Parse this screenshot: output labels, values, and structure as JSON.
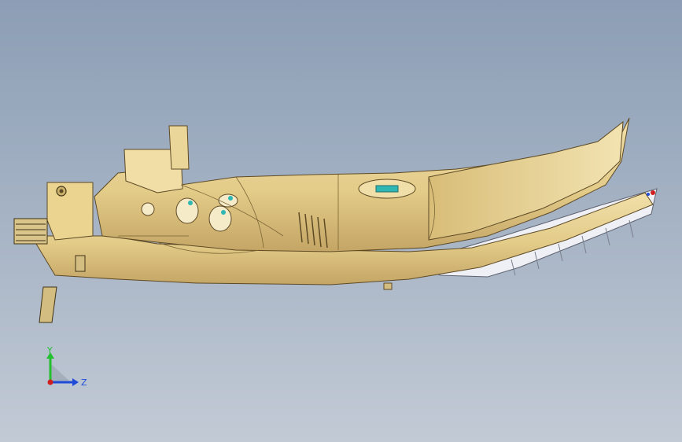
{
  "viewport": {
    "background_top": "#8c9eb5",
    "background_bottom": "#c2cad5",
    "model_color": "#e6d08f",
    "model_shadow": "#b89a5b",
    "edge_color": "#5e4a25",
    "accent_cyan": "#2fb7b3",
    "light_part": "#eef0f5"
  },
  "triad": {
    "y_label": "Y",
    "z_label": "Z",
    "y_color": "#22c02f",
    "z_color": "#1f4bd8",
    "x_color": "#d01f1f"
  }
}
